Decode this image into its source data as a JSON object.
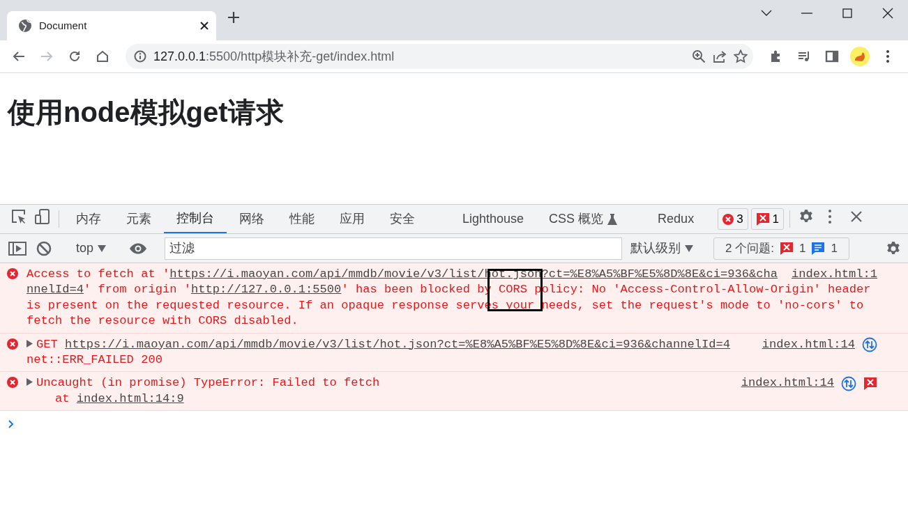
{
  "browser": {
    "tabs": [
      {
        "title": "Document",
        "selected": true
      }
    ],
    "address": {
      "host": "127.0.0.1",
      "rest": ":5500/http模块补充-get/index.html"
    }
  },
  "page": {
    "heading": "使用node模拟get请求"
  },
  "devtools": {
    "tabs": [
      {
        "label": "内存",
        "selected": false,
        "kind": "plain"
      },
      {
        "label": "元素",
        "selected": false,
        "kind": "plain"
      },
      {
        "label": "控制台",
        "selected": true,
        "kind": "plain"
      },
      {
        "label": "网络",
        "selected": false,
        "kind": "plain"
      },
      {
        "label": "性能",
        "selected": false,
        "kind": "plain"
      },
      {
        "label": "应用",
        "selected": false,
        "kind": "plain"
      },
      {
        "label": "安全",
        "selected": false,
        "kind": "plain"
      },
      {
        "label": "Lighthouse",
        "selected": false,
        "kind": "plain"
      },
      {
        "label": "CSS 概览",
        "selected": false,
        "kind": "experiment"
      },
      {
        "label": "Redux",
        "selected": false,
        "kind": "plain"
      }
    ],
    "error_count": "3",
    "issue_count": "1",
    "console_toolbar": {
      "context": "top",
      "filter_placeholder": "过滤",
      "level": "默认级别",
      "issues_label": "2 个问题:",
      "issues_error": "1",
      "issues_info": "1"
    },
    "messages": [
      {
        "kind": "error",
        "expandable": false,
        "source": "index.html:1",
        "annotated": true,
        "lines": [
          [
            {
              "kind": "text",
              "text": "Access to fetch at '"
            },
            {
              "kind": "link",
              "text": "https://i.maoyan.com/api/mmdb/movie/v3/list/hot.json?ct=%E8%A5%BF%E5%8D%8E&ci=936&cha"
            }
          ],
          [
            {
              "kind": "link",
              "text": "nnelId=4"
            },
            {
              "kind": "text",
              "text": "' from origin '"
            },
            {
              "kind": "link",
              "text": "http://127.0.0.1:5500"
            },
            {
              "kind": "text",
              "text": "' has been blocked by CORS policy: No 'Access-Control-Allow-Origin' header"
            }
          ],
          [
            {
              "kind": "text",
              "text": "is present on the requested resource. If an opaque response serves your needs, set the request's mode to 'no-cors' to"
            }
          ],
          [
            {
              "kind": "text",
              "text": "fetch the resource with CORS disabled."
            }
          ]
        ]
      },
      {
        "kind": "error",
        "expandable": true,
        "source": "index.html:14",
        "badges": [
          {
            "kind": "network"
          }
        ],
        "annotated": false,
        "lines": [
          [
            {
              "kind": "text",
              "text": "GET "
            },
            {
              "kind": "link",
              "text": "https://i.maoyan.com/api/mmdb/movie/v3/list/hot.json?ct=%E8%A5%BF%E5%8D%8E&ci=936&channelId=4"
            }
          ],
          [
            {
              "kind": "text",
              "text": "net::ERR_FAILED 200"
            }
          ]
        ]
      },
      {
        "kind": "error",
        "expandable": true,
        "source": "index.html:14",
        "badges": [
          {
            "kind": "network"
          },
          {
            "kind": "issue"
          }
        ],
        "annotated": false,
        "lines": [
          [
            {
              "kind": "text",
              "text": "Uncaught (in promise) TypeError: Failed to fetch"
            }
          ],
          [
            {
              "kind": "text",
              "text": "    at "
            },
            {
              "kind": "link",
              "text": "index.html:14:9"
            }
          ]
        ]
      }
    ]
  }
}
